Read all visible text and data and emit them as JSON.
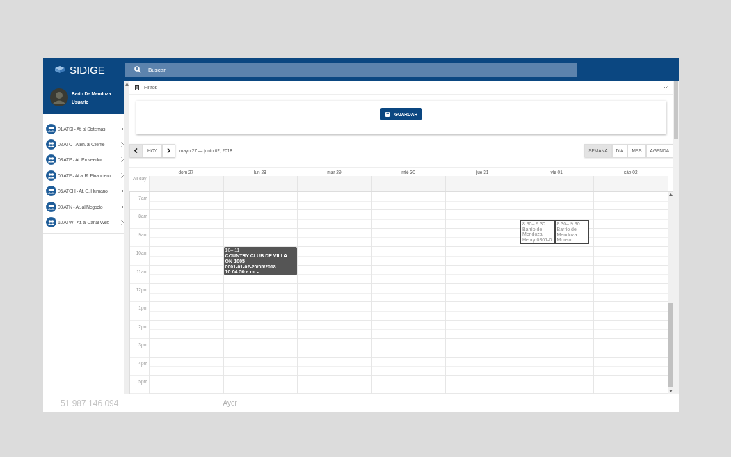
{
  "app": {
    "logo": "SIDIGE"
  },
  "search": {
    "placeholder": "Buscar"
  },
  "profile": {
    "name": "Bario De Mendoza",
    "role": "Usuario"
  },
  "sidebar": {
    "items": [
      {
        "label": "01 ATSI - At. al Sistemas"
      },
      {
        "label": "02 ATC - Aten. al Cliente"
      },
      {
        "label": "03 ATP - At. Proveedor"
      },
      {
        "label": "05 ATF - At al R. Financiero"
      },
      {
        "label": "06 ATCH - At. C. Humano"
      },
      {
        "label": "09 ATN - At. al Negocio"
      },
      {
        "label": "10 ATW - At. al Canal Web"
      }
    ]
  },
  "filters": {
    "title": "Filtros",
    "save_button": "GUARDAR"
  },
  "calendar": {
    "range": "mayo 27 — junio 02, 2018",
    "today_button": "HOY",
    "views": [
      {
        "label": "SEMANA",
        "selected": true
      },
      {
        "label": "DIA",
        "selected": false
      },
      {
        "label": "MES",
        "selected": false
      },
      {
        "label": "AGENDA",
        "selected": false
      }
    ],
    "all_day_label": "All day",
    "hours": [
      "7am",
      "8am",
      "9am",
      "10am",
      "11am",
      "12pm",
      "1pm",
      "2pm",
      "3pm",
      "4pm",
      "5pm"
    ],
    "days": [
      {
        "label": "dom 27"
      },
      {
        "label": "lun 28",
        "events": [
          {
            "kind": "filled",
            "time": "10– 11",
            "line_1": "COUNTRY CLUB DE VILLA : ON-1005-",
            "line_2": "0001-01-02-20/05/2018 10:04:50 a.m. -"
          }
        ]
      },
      {
        "label": "mar 29"
      },
      {
        "label": "mié 30"
      },
      {
        "label": "jue 31"
      },
      {
        "label": "vie 01",
        "events": [
          {
            "kind": "outlined",
            "time": "8:30– 9:30",
            "line_1": "Barrio de Mendoza",
            "line_2": "Henry 0301-0"
          },
          {
            "kind": "outlined",
            "time": "8:30– 9:30",
            "line_1": "Barrio de",
            "line_2": "Mendoza Monso"
          }
        ]
      },
      {
        "label": "sáb 02"
      }
    ]
  },
  "background_ghost": {
    "phone": "+51 987 146 094",
    "time": "Ayer"
  }
}
